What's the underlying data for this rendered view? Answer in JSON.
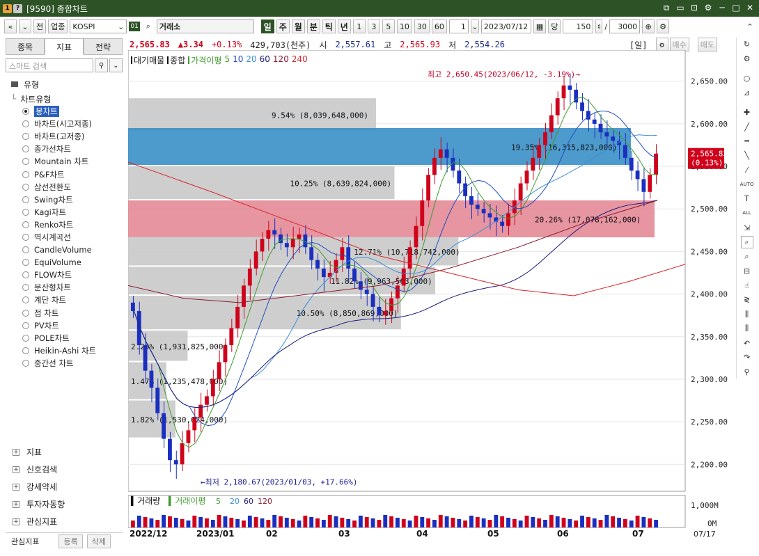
{
  "window": {
    "title": "[9590] 종합차트",
    "icon_left_1": "1",
    "icon_left_2": "?",
    "controls": [
      "⧉",
      "▭",
      "⊡",
      "⚙",
      "─",
      "□",
      "✕"
    ]
  },
  "toolbar": {
    "back": "«",
    "fold": "»",
    "btn_prev": "전",
    "btn_sector": "업종",
    "market_code": "KOSPI",
    "market_btn": "01",
    "market_name": "거래소",
    "periods": [
      "일",
      "주",
      "월",
      "분",
      "틱",
      "년"
    ],
    "selected_period": "일",
    "intervals": [
      "1",
      "3",
      "5",
      "10",
      "30",
      "60"
    ],
    "counter": "1",
    "date": "2023/07/12",
    "single_btn": "당",
    "count": "150",
    "total": "3000",
    "slash": "/"
  },
  "quote": {
    "price": "2,565.83",
    "change": "▲3.34",
    "change_pct": "+0.13%",
    "volume": "429,703(천주)",
    "open_label": "시",
    "open": "2,557.61",
    "high_label": "고",
    "high": "2,565.93",
    "low_label": "저",
    "low": "2,554.26",
    "period_tag": "[일]",
    "buy": "매수",
    "sell": "매도"
  },
  "left_panel": {
    "tabs": [
      "종목",
      "지표",
      "전략"
    ],
    "selected_tab": "지표",
    "search_placeholder": "스마트 검색",
    "group_title": "유형",
    "subgroup_title": "차트유형",
    "chart_types": [
      "봉차트",
      "바차트(시고저종)",
      "바차트(고저종)",
      "종가선차트",
      "Mountain 차트",
      "P&F차트",
      "삼선전환도",
      "Swing차트",
      "Kagi차트",
      "Renko차트",
      "역시계곡선",
      "CandleVolume",
      "EquiVolume",
      "FLOW차트",
      "분산형차트",
      "계단 차트",
      "점 차트",
      "PV차트",
      "POLE차트",
      "Heikin-Ashi 차트",
      "중간선 차트"
    ],
    "selected_chart_type": "봉차트",
    "bottom_groups": [
      "지표",
      "신호검색",
      "강세약세",
      "투자자동향",
      "관심지표"
    ],
    "footer_label": "관심지표",
    "footer_btn_add": "등록",
    "footer_btn_del": "삭제"
  },
  "chart": {
    "legend_main": [
      "대기매물",
      "종합"
    ],
    "ma_label": "가격이평",
    "ma_periods": [
      "5",
      "10",
      "20",
      "60",
      "120",
      "240"
    ],
    "ma_colors": [
      "#3f9b2e",
      "#1f4fbf",
      "#3a8fd8",
      "#1a1a7a",
      "#8b1a2e",
      "#d8252a"
    ],
    "volume_legend": [
      "거래량",
      "거래이평"
    ],
    "volume_ma_periods": [
      "5",
      "20",
      "60",
      "120"
    ],
    "max_annotation": "최고 2,650.45(2023/06/12, -3.19%)",
    "min_annotation": "최저 2,180.67(2023/01/03, +17.66%)",
    "current_price_tag": "2,565.83",
    "current_price_pct": "(0.13%)",
    "y_ticks": [
      "2,650.00",
      "2,600.00",
      "2,550.00",
      "2,500.00",
      "2,450.00",
      "2,400.00",
      "2,350.00",
      "2,300.00",
      "2,250.00",
      "2,200.00"
    ],
    "volume_ticks": [
      "1,000M",
      "0M"
    ],
    "x_labels": [
      "2022/12",
      "2023/01",
      "02",
      "03",
      "04",
      "05",
      "06",
      "07"
    ],
    "x_end_label": "07/17",
    "supply_bands": [
      {
        "label": "9.54% (8,039,648,000)",
        "pct": 9.54,
        "highlight": ""
      },
      {
        "label": "19.35% (16,315,823,000)",
        "pct": 19.35,
        "highlight": "blue"
      },
      {
        "label": "10.25% (8,639,824,000)",
        "pct": 10.25,
        "highlight": ""
      },
      {
        "label": "20.26% (17,078,162,000)",
        "pct": 20.26,
        "highlight": "red"
      },
      {
        "label": "12.71% (10,718,742,000)",
        "pct": 12.71,
        "highlight": ""
      },
      {
        "label": "11.82% (9,963,563,000)",
        "pct": 11.82,
        "highlight": ""
      },
      {
        "label": "10.50% (8,850,869,000)",
        "pct": 10.5,
        "highlight": ""
      },
      {
        "label": "2.29% (1,931,825,000)",
        "pct": 2.29,
        "highlight": ""
      },
      {
        "label": "1.47% (1,235,478,000)",
        "pct": 1.47,
        "highlight": ""
      },
      {
        "label": "1.82% (1,530,624,000)",
        "pct": 1.82,
        "highlight": ""
      }
    ],
    "price_ticks": [
      2650,
      2600,
      2550,
      2500,
      2450,
      2400,
      2350,
      2300,
      2250,
      2200
    ],
    "close_series": [
      2380,
      2340,
      2310,
      2290,
      2260,
      2230,
      2205,
      2200,
      2225,
      2240,
      2255,
      2270,
      2280,
      2300,
      2320,
      2340,
      2360,
      2385,
      2410,
      2430,
      2450,
      2465,
      2475,
      2470,
      2460,
      2455,
      2465,
      2470,
      2455,
      2440,
      2430,
      2420,
      2425,
      2440,
      2455,
      2430,
      2415,
      2405,
      2400,
      2385,
      2375,
      2380,
      2395,
      2410,
      2430,
      2455,
      2480,
      2510,
      2540,
      2560,
      2570,
      2560,
      2545,
      2530,
      2515,
      2505,
      2500,
      2495,
      2490,
      2485,
      2480,
      2495,
      2510,
      2530,
      2545,
      2560,
      2575,
      2590,
      2610,
      2630,
      2645,
      2640,
      2625,
      2615,
      2605,
      2600,
      2590,
      2585,
      2580,
      2575,
      2560,
      2545,
      2535,
      2520,
      2540,
      2565
    ]
  }
}
